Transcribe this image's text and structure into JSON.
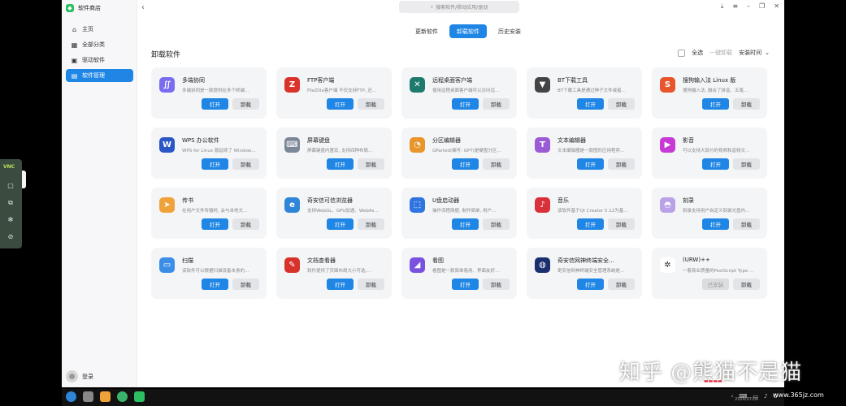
{
  "app": {
    "title": "软件商店"
  },
  "sidebar": {
    "items": [
      {
        "label": "主页",
        "icon": "home-icon",
        "glyph": "⌂"
      },
      {
        "label": "全部分类",
        "icon": "grid-icon",
        "glyph": "▦"
      },
      {
        "label": "驱动软件",
        "icon": "driver-icon",
        "glyph": "▣"
      },
      {
        "label": "软件管理",
        "icon": "manage-icon",
        "glyph": "▤",
        "active": true
      }
    ],
    "user": "登录"
  },
  "search": {
    "placeholder": "搜索软件/移动应用/驱动"
  },
  "tabs": [
    {
      "label": "更新软件"
    },
    {
      "label": "卸载软件",
      "active": true
    },
    {
      "label": "历史安装"
    }
  ],
  "page": {
    "title": "卸载软件",
    "select_all": "全选",
    "batch_uninstall": "一键卸载",
    "sort_label": "安装时间"
  },
  "buttons": {
    "open": "打开",
    "uninstall": "卸载",
    "installed": "已安装"
  },
  "apps": [
    {
      "name": "多端协同",
      "desc": "多端协同是一款提供在多个终端…",
      "color": "#7a6cf0",
      "glyph": "∬"
    },
    {
      "name": "FTP客户端",
      "desc": "FileZilla客户端 不仅支持FTP, 还…",
      "color": "#d9332b",
      "glyph": "Z"
    },
    {
      "name": "远程桌面客户端",
      "desc": "使用远程桌面客户端可以访问远…",
      "color": "#1f7a6e",
      "glyph": "✕"
    },
    {
      "name": "BT下载工具",
      "desc": "BT下载工具是通过种子文件或者…",
      "color": "#444444",
      "glyph": "▼"
    },
    {
      "name": "搜狗输入法 Linux 版",
      "desc": "搜狗输入法, 融合了拼音、五笔…",
      "color": "#e8542b",
      "glyph": "S"
    },
    {
      "name": "WPS 办公软件",
      "desc": "WPS for Linux 版延续了 Window…",
      "color": "#2a56c6",
      "glyph": "W"
    },
    {
      "name": "屏幕键盘",
      "desc": "屏幕键盘内置宏, 支持四种布局…",
      "color": "#7c8798",
      "glyph": "⌨"
    },
    {
      "name": "分区编辑器",
      "desc": "GParted(编写: GPT)是硬盘分区…",
      "color": "#e8952b",
      "glyph": "◔"
    },
    {
      "name": "文本编辑器",
      "desc": "文本编辑器是一款图形应用程序…",
      "color": "#9b5bd4",
      "glyph": "T"
    },
    {
      "name": "影音",
      "desc": "可以支持大部分的视频和音频文…",
      "color": "#c73ad6",
      "glyph": "▶"
    },
    {
      "name": "传书",
      "desc": "在用户文件传输时, 会与本地文…",
      "color": "#f0a23a",
      "glyph": "➤"
    },
    {
      "name": "奇安信可信浏览器",
      "desc": "支持WebGL、GPU加速、WebAs…",
      "color": "#2f86d8",
      "glyph": "e"
    },
    {
      "name": "U盘启动器",
      "desc": "操作流程简便, 制作简单, 用户…",
      "color": "#2f74e0",
      "glyph": "⬚"
    },
    {
      "name": "音乐",
      "desc": "该软件基于Qt Creator 5.12为基…",
      "color": "#d9313a",
      "glyph": "♪"
    },
    {
      "name": "刻录",
      "desc": "刻录支持用户自定义刻录光盘内…",
      "color": "#b9a2e8",
      "glyph": "◓"
    },
    {
      "name": "扫描",
      "desc": "该软件可以根据扫描设备本身的…",
      "color": "#3c8de6",
      "glyph": "▭"
    },
    {
      "name": "文档查看器",
      "desc": "软件提供了页面布局大小可选,…",
      "color": "#d8322c",
      "glyph": "✎"
    },
    {
      "name": "看图",
      "desc": "看图是一款简单易用、界面友好…",
      "color": "#7a52e0",
      "glyph": "◢"
    },
    {
      "name": "奇安信网神终端安全…",
      "desc": "奇安信网神终端安全管理系统是…",
      "color": "#1a2f6e",
      "glyph": "◍"
    },
    {
      "name": "(URW)++",
      "desc": "一套商业质量的PostScript Type …",
      "color": "#ffffff",
      "glyph": "✲",
      "installed": true
    }
  ],
  "vnc": {
    "logo": "VNC"
  },
  "watermark": {
    "text": "知乎 @熊猫不是猫",
    "site": "www.365jz.com",
    "date": "2024/07/08"
  }
}
